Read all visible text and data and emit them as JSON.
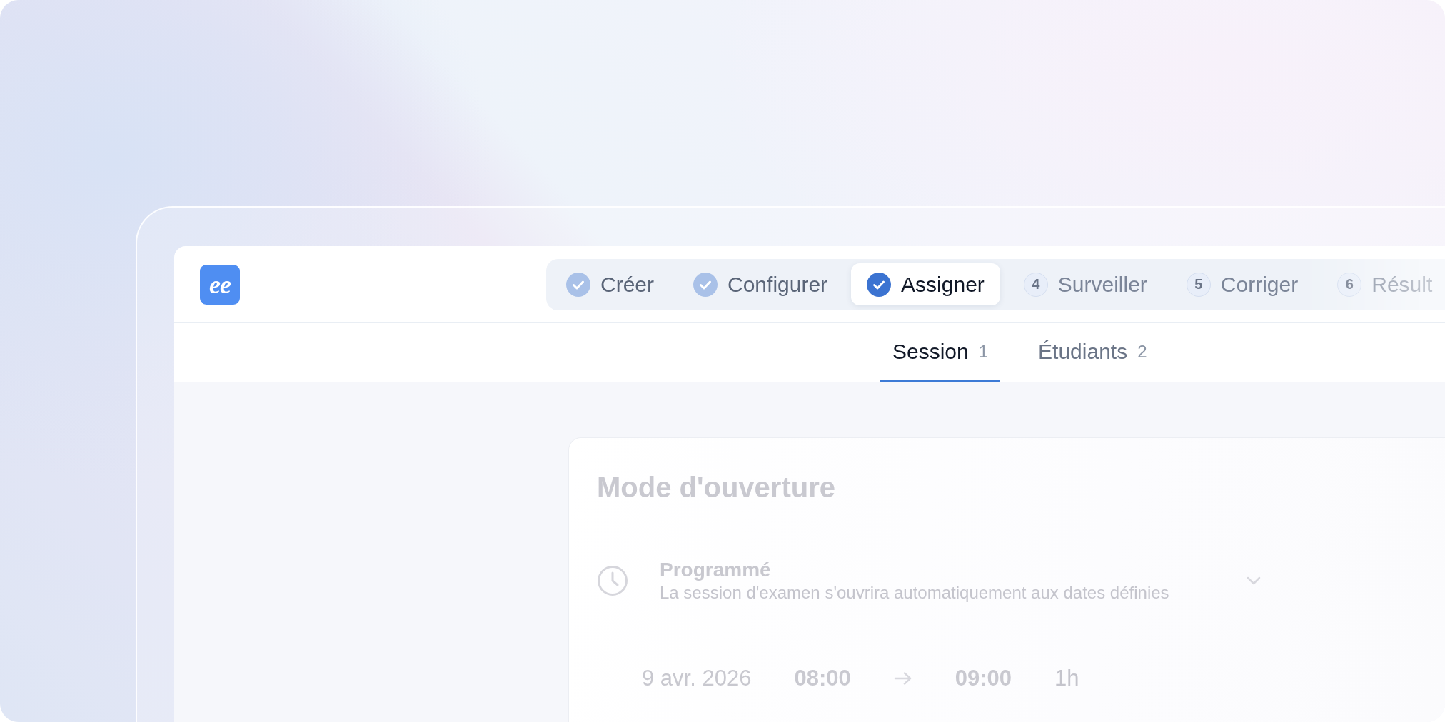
{
  "logo": {
    "text": "ee"
  },
  "stepper": {
    "steps": [
      {
        "label": "Créer",
        "completed": true,
        "selected": false
      },
      {
        "label": "Configurer",
        "completed": true,
        "selected": false
      },
      {
        "label": "Assigner",
        "completed": true,
        "selected": true
      },
      {
        "label": "Surveiller",
        "number": "4",
        "completed": false,
        "selected": false
      },
      {
        "label": "Corriger",
        "number": "5",
        "completed": false,
        "selected": false
      },
      {
        "label": "Résult",
        "number": "6",
        "completed": false,
        "selected": false
      }
    ]
  },
  "tabs": [
    {
      "label": "Session",
      "count": "1",
      "selected": true
    },
    {
      "label": "Étudiants",
      "count": "2",
      "selected": false
    }
  ],
  "card": {
    "title": "Mode d'ouverture",
    "mode": {
      "label": "Programmé",
      "description": "La session d'examen s'ouvrira automatiquement aux dates définies"
    },
    "schedule": {
      "date": "9 avr. 2026",
      "start": "08:00",
      "end": "09:00",
      "duration": "1h"
    }
  }
}
